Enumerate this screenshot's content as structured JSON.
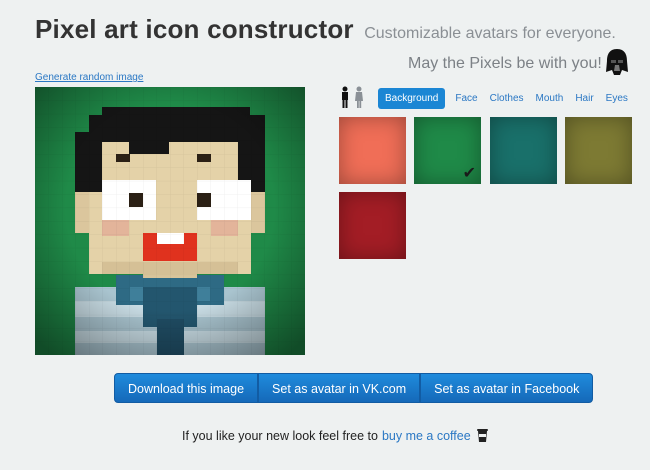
{
  "header": {
    "title": "Pixel art icon constructor",
    "subtitle": "Customizable avatars for everyone.",
    "tagline": "May the Pixels be with you!",
    "tagline_icon": "darth-vader-icon"
  },
  "generate_link": "Generate random image",
  "gender_icons": [
    "male-icon",
    "female-icon"
  ],
  "tabs": [
    {
      "label": "Background",
      "active": true
    },
    {
      "label": "Face",
      "active": false
    },
    {
      "label": "Clothes",
      "active": false
    },
    {
      "label": "Mouth",
      "active": false
    },
    {
      "label": "Hair",
      "active": false
    },
    {
      "label": "Eyes",
      "active": false
    }
  ],
  "swatches": [
    {
      "color": "#f06e57",
      "selected": false
    },
    {
      "color": "#1f8a48",
      "selected": true
    },
    {
      "color": "#19706a",
      "selected": false
    },
    {
      "color": "#7d7a33",
      "selected": false
    },
    {
      "color": "#a31d25",
      "selected": false
    }
  ],
  "selected_mark": "✔",
  "buttons": {
    "download": "Download this image",
    "vk": "Set as avatar in VK.com",
    "facebook": "Set as avatar in Facebook"
  },
  "footer": {
    "text": "If you like your new look feel free to",
    "link": "buy me a coffee",
    "icon": "coffee-cup-icon"
  },
  "colors": {
    "link": "#2b78c4",
    "button": "#1b7bcc",
    "avatar_bg": "#1f8a48"
  }
}
